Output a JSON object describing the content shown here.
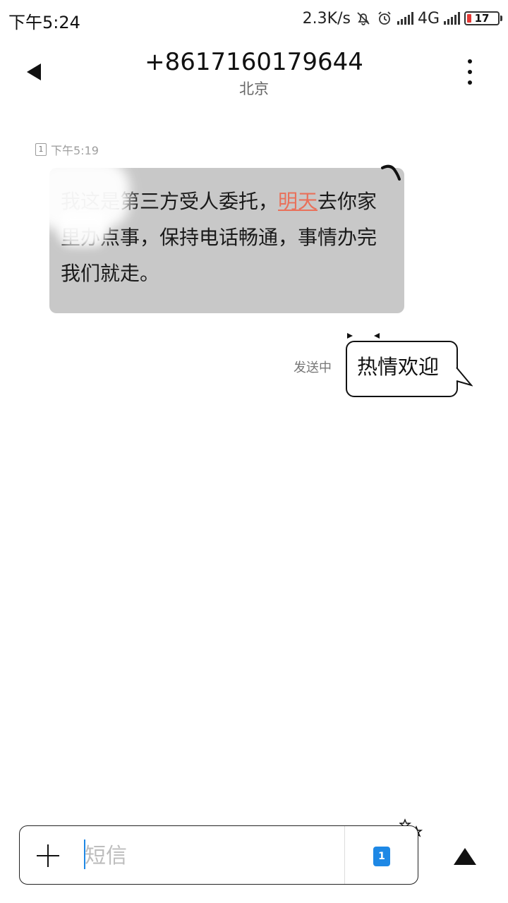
{
  "status_bar": {
    "time": "下午5:24",
    "net_speed": "2.3K/s",
    "network": "4G",
    "battery": "17"
  },
  "header": {
    "title": "+8617160179644",
    "subtitle": "北京"
  },
  "messages": {
    "incoming": {
      "sim": "1",
      "time": "下午5:19",
      "text_before": "我这是第三方受人委托，",
      "text_link": "明天",
      "text_after": "去你家里办点事，保持电话畅通，事情办完我们就走。"
    },
    "outgoing": {
      "status": "发送中",
      "text": "热情欢迎"
    }
  },
  "composer": {
    "placeholder": "短信",
    "sim_label": "1"
  },
  "colors": {
    "incoming_bubble": "#c8c8c8",
    "link": "#e9705a",
    "accent": "#1e88e5"
  }
}
